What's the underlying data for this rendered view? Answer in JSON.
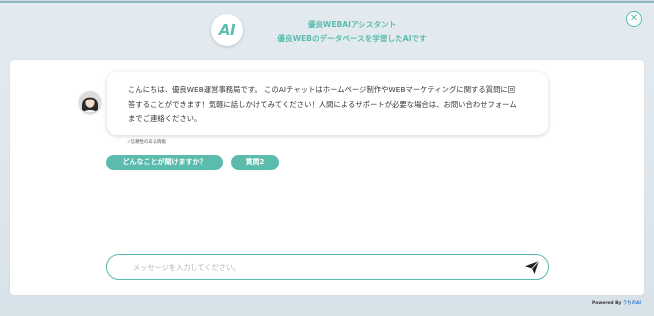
{
  "header": {
    "logo_text": "AI",
    "title_line1": "優良WEBAIアシスタント",
    "title_line2": "優良WEBのデータベースを学習したAIです",
    "close_icon": "close-icon"
  },
  "chat": {
    "assistant_message_lines": [
      "こんにちは、優良WEB運営事務局です。 このAIチャットはホームページ制作やWEBマーケティングに関する質問に回",
      "答することができます！気軽に話しかけてみてください！人間によるサポートが必要な場合は、お問い合わせフォーム",
      "までご連絡ください。"
    ],
    "reliability_note": "✓信頼性のある情報",
    "suggestions": [
      "どんなことが聞けますか？",
      "質問2"
    ]
  },
  "composer": {
    "placeholder": "メッセージを入力してください。",
    "send_icon": "send-icon"
  },
  "footer": {
    "powered_by": "Powered By",
    "brand": "うちのAI"
  },
  "colors": {
    "accent": "#5bbcae",
    "background": "#dde6ec",
    "panel": "#ffffff"
  }
}
